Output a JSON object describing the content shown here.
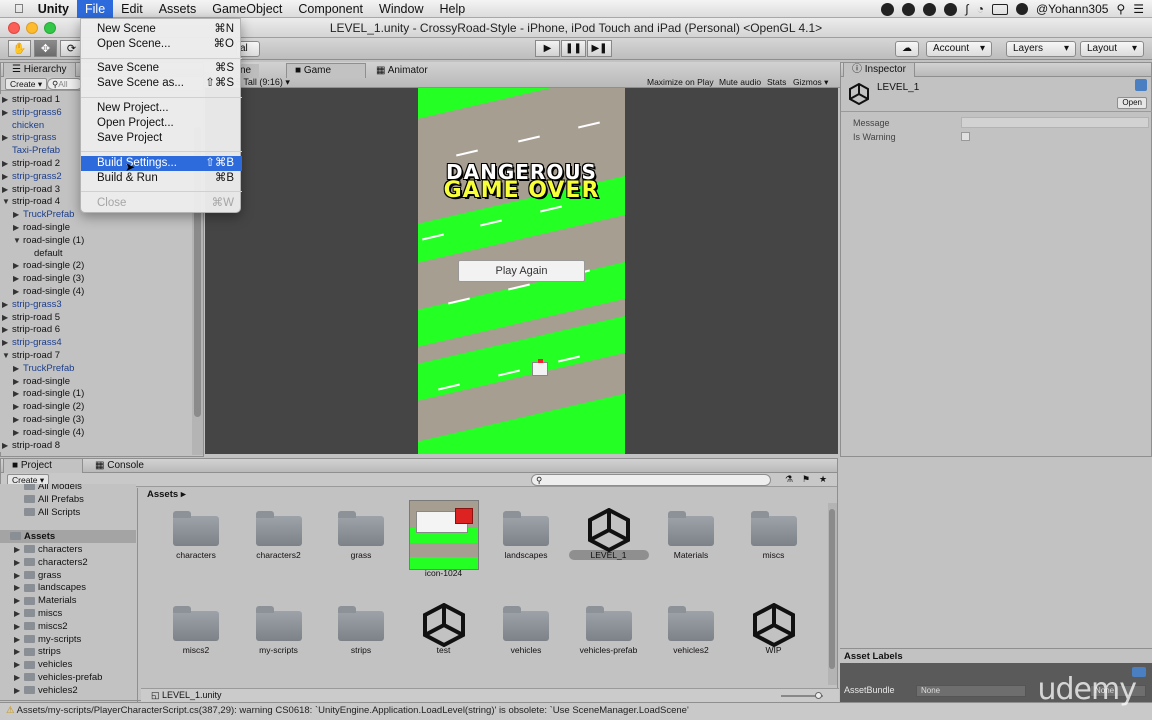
{
  "menubar": {
    "items": [
      "Unity",
      "File",
      "Edit",
      "Assets",
      "GameObject",
      "Component",
      "Window",
      "Help"
    ],
    "user": "@Yohann305"
  },
  "window": {
    "title": "LEVEL_1.unity - CrossyRoad-Style - iPhone, iPod Touch and iPad (Personal) <OpenGL 4.1>"
  },
  "toolbar": {
    "pivot_fragment": "al",
    "account": "Account",
    "layers": "Layers",
    "layout": "Layout"
  },
  "file_menu": {
    "items": [
      {
        "label": "New Scene",
        "shortcut": "⌘N"
      },
      {
        "label": "Open Scene...",
        "shortcut": "⌘O"
      },
      {
        "label": "Save Scene",
        "shortcut": "⌘S"
      },
      {
        "label": "Save Scene as...",
        "shortcut": "⇧⌘S"
      },
      {
        "label": "New Project..."
      },
      {
        "label": "Open Project..."
      },
      {
        "label": "Save Project"
      },
      {
        "label": "Build Settings...",
        "shortcut": "⇧⌘B"
      },
      {
        "label": "Build & Run",
        "shortcut": "⌘B"
      },
      {
        "label": "Close",
        "shortcut": "⌘W"
      }
    ]
  },
  "hierarchy": {
    "tab": "Hierarchy",
    "create": "Create",
    "search_placeholder": "All",
    "rows": [
      {
        "label": "strip-road 1",
        "prefab": false,
        "depth": 0,
        "tri": "▶"
      },
      {
        "label": "strip-grass6",
        "prefab": true,
        "depth": 0,
        "tri": "▶"
      },
      {
        "label": "chicken",
        "prefab": true,
        "depth": 0,
        "tri": ""
      },
      {
        "label": "strip-grass",
        "prefab": true,
        "depth": 0,
        "tri": "▶"
      },
      {
        "label": "Taxi-Prefab",
        "prefab": true,
        "depth": 0,
        "tri": ""
      },
      {
        "label": "strip-road 2",
        "prefab": false,
        "depth": 0,
        "tri": "▶"
      },
      {
        "label": "strip-grass2",
        "prefab": true,
        "depth": 0,
        "tri": "▶"
      },
      {
        "label": "strip-road 3",
        "prefab": false,
        "depth": 0,
        "tri": "▶"
      },
      {
        "label": "strip-road 4",
        "prefab": false,
        "depth": 0,
        "tri": "▼"
      },
      {
        "label": "TruckPrefab",
        "prefab": true,
        "depth": 1,
        "tri": "▶"
      },
      {
        "label": "road-single",
        "prefab": false,
        "depth": 1,
        "tri": "▶"
      },
      {
        "label": "road-single (1)",
        "prefab": false,
        "depth": 1,
        "tri": "▼"
      },
      {
        "label": "default",
        "prefab": false,
        "depth": 2,
        "tri": ""
      },
      {
        "label": "road-single (2)",
        "prefab": false,
        "depth": 1,
        "tri": "▶"
      },
      {
        "label": "road-single (3)",
        "prefab": false,
        "depth": 1,
        "tri": "▶"
      },
      {
        "label": "road-single (4)",
        "prefab": false,
        "depth": 1,
        "tri": "▶"
      },
      {
        "label": "strip-grass3",
        "prefab": true,
        "depth": 0,
        "tri": "▶"
      },
      {
        "label": "strip-road 5",
        "prefab": false,
        "depth": 0,
        "tri": "▶"
      },
      {
        "label": "strip-road 6",
        "prefab": false,
        "depth": 0,
        "tri": "▶"
      },
      {
        "label": "strip-grass4",
        "prefab": true,
        "depth": 0,
        "tri": "▶"
      },
      {
        "label": "strip-road 7",
        "prefab": false,
        "depth": 0,
        "tri": "▼"
      },
      {
        "label": "TruckPrefab",
        "prefab": true,
        "depth": 1,
        "tri": "▶"
      },
      {
        "label": "road-single",
        "prefab": false,
        "depth": 1,
        "tri": "▶"
      },
      {
        "label": "road-single (1)",
        "prefab": false,
        "depth": 1,
        "tri": "▶"
      },
      {
        "label": "road-single (2)",
        "prefab": false,
        "depth": 1,
        "tri": "▶"
      },
      {
        "label": "road-single (3)",
        "prefab": false,
        "depth": 1,
        "tri": "▶"
      },
      {
        "label": "road-single (4)",
        "prefab": false,
        "depth": 1,
        "tri": "▶"
      },
      {
        "label": "strip-road 8",
        "prefab": false,
        "depth": 0,
        "tri": "▶"
      }
    ]
  },
  "center_tabs": {
    "scene_fragment": "ne",
    "game": "Game",
    "animator": "Animator",
    "aspect": "5 Tall (9:16)",
    "maximize": "Maximize on Play",
    "mute": "Mute audio",
    "stats": "Stats",
    "gizmos": "Gizmos"
  },
  "game": {
    "line1": "DANGEROUS",
    "line2": "GAME OVER",
    "button": "Play Again"
  },
  "inspector": {
    "tab": "Inspector",
    "object_name": "LEVEL_1",
    "open": "Open",
    "fields": [
      {
        "label": "Message"
      },
      {
        "label": "Is Warning"
      }
    ],
    "asset_labels": "Asset Labels",
    "asset_bundle": "AssetBundle",
    "bundle_value": "None",
    "bundle_value2": "None"
  },
  "project": {
    "tab": "Project",
    "console": "Console",
    "create": "Create",
    "breadcrumb": "Assets",
    "favorites": [
      "All Models",
      "All Prefabs",
      "All Scripts"
    ],
    "tree_root": "Assets",
    "tree": [
      "characters",
      "characters2",
      "grass",
      "landscapes",
      "Materials",
      "miscs",
      "miscs2",
      "my-scripts",
      "strips",
      "vehicles",
      "vehicles-prefab",
      "vehicles2"
    ],
    "assets": [
      {
        "name": "characters",
        "kind": "folder"
      },
      {
        "name": "characters2",
        "kind": "folder"
      },
      {
        "name": "grass",
        "kind": "folder"
      },
      {
        "name": "icon-1024",
        "kind": "image"
      },
      {
        "name": "landscapes",
        "kind": "folder"
      },
      {
        "name": "LEVEL_1",
        "kind": "scene"
      },
      {
        "name": "Materials",
        "kind": "folder"
      },
      {
        "name": "miscs",
        "kind": "folder"
      },
      {
        "name": "miscs2",
        "kind": "folder"
      },
      {
        "name": "my-scripts",
        "kind": "folder"
      },
      {
        "name": "strips",
        "kind": "folder"
      },
      {
        "name": "test",
        "kind": "scene"
      },
      {
        "name": "vehicles",
        "kind": "folder"
      },
      {
        "name": "vehicles-prefab",
        "kind": "folder"
      },
      {
        "name": "vehicles2",
        "kind": "folder"
      },
      {
        "name": "WIP",
        "kind": "scene"
      }
    ],
    "selected_file": "LEVEL_1.unity"
  },
  "statusbar": {
    "message": "Assets/my-scripts/PlayerCharacterScript.cs(387,29): warning CS0618: `UnityEngine.Application.LoadLevel(string)' is obsolete: `Use SceneManager.LoadScene'"
  },
  "watermark": "udemy"
}
